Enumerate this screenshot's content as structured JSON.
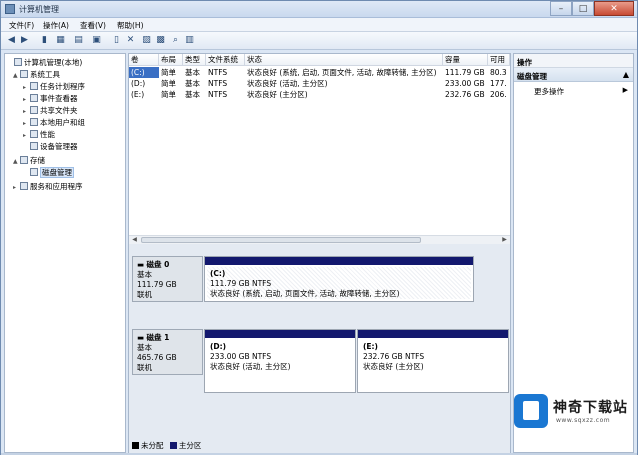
{
  "window": {
    "title": "计算机管理"
  },
  "menu": [
    "文件(F)",
    "操作(A)",
    "查看(V)",
    "帮助(H)"
  ],
  "toolbar_icons": [
    "back-arrow-icon",
    "forward-arrow-icon",
    "up-folder-icon",
    "console-tree-icon",
    "pane-icon",
    "help-icon",
    "properties-icon",
    "delete-icon",
    "settings-icon",
    "open-icon",
    "search-icon",
    "disk-view-icon"
  ],
  "tree": [
    {
      "label": "计算机管理(本地)",
      "icon": "computer-icon",
      "twisty": ""
    },
    {
      "label": "系统工具",
      "icon": "tools-icon",
      "twisty": "▲"
    },
    {
      "label": "任务计划程序",
      "icon": "task-scheduler-icon",
      "twisty": "▸"
    },
    {
      "label": "事件查看器",
      "icon": "event-viewer-icon",
      "twisty": "▸"
    },
    {
      "label": "共享文件夹",
      "icon": "shared-folder-icon",
      "twisty": "▸"
    },
    {
      "label": "本地用户和组",
      "icon": "users-icon",
      "twisty": "▸"
    },
    {
      "label": "性能",
      "icon": "performance-icon",
      "twisty": "▸"
    },
    {
      "label": "设备管理器",
      "icon": "device-manager-icon",
      "twisty": ""
    },
    {
      "label": "存储",
      "icon": "storage-icon",
      "twisty": "▲"
    },
    {
      "label": "磁盘管理",
      "icon": "disk-management-icon",
      "twisty": ""
    },
    {
      "label": "服务和应用程序",
      "icon": "services-icon",
      "twisty": "▸"
    }
  ],
  "volumes": {
    "headers": [
      "卷",
      "布局",
      "类型",
      "文件系统",
      "状态",
      "容量",
      "可用"
    ],
    "rows": [
      [
        "(C:)",
        "简单",
        "基本",
        "NTFS",
        "状态良好 (系统, 启动, 页面文件, 活动, 故障转储, 主分区)",
        "111.79 GB",
        "80.3"
      ],
      [
        "(D:)",
        "简单",
        "基本",
        "NTFS",
        "状态良好 (活动, 主分区)",
        "233.00 GB",
        "177."
      ],
      [
        "(E:)",
        "简单",
        "基本",
        "NTFS",
        "状态良好 (主分区)",
        "232.76 GB",
        "206."
      ]
    ]
  },
  "disks": [
    {
      "name": "磁盘 0",
      "type": "基本",
      "size": "111.79 GB",
      "status": "联机",
      "partitions": [
        {
          "letter": "(C:)",
          "size": "111.79 GB NTFS",
          "status": "状态良好 (系统, 启动, 页面文件, 活动, 故障转储, 主分区)"
        }
      ]
    },
    {
      "name": "磁盘 1",
      "type": "基本",
      "size": "465.76 GB",
      "status": "联机",
      "partitions": [
        {
          "letter": "(D:)",
          "size": "233.00 GB NTFS",
          "status": "状态良好 (活动, 主分区)"
        },
        {
          "letter": "(E:)",
          "size": "232.76 GB NTFS",
          "status": "状态良好 (主分区)"
        }
      ]
    }
  ],
  "legend": [
    {
      "label": "未分配",
      "color": "#000000"
    },
    {
      "label": "主分区",
      "color": "#13186e"
    }
  ],
  "actions": {
    "header": "操作",
    "section": "磁盘管理",
    "more": "更多操作"
  },
  "watermark": {
    "title": "神奇下载站",
    "url": "www.sqxzz.com"
  }
}
